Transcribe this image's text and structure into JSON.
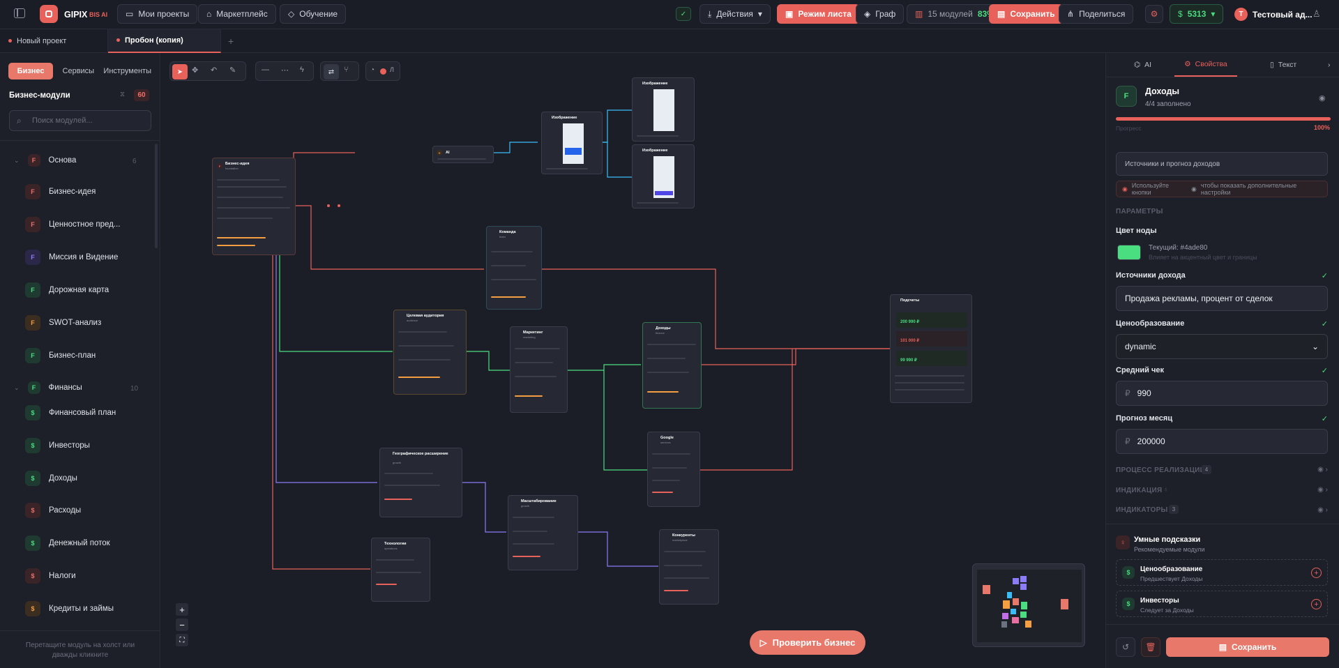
{
  "topbar": {
    "brand": "GIPIX",
    "brand_suffix": "BIS AI",
    "nav": [
      "Мои проекты",
      "Маркетплейс",
      "Обучение"
    ],
    "actions_label": "Действия",
    "sheet_mode_label": "Режим листа",
    "graph_label": "Граф",
    "modules_count": "15 модулей",
    "modules_percent": "83%",
    "save_label": "Сохранить",
    "share_label": "Поделиться",
    "credits": "5313",
    "user_initial": "Т",
    "user_name": "Тестовый ад..."
  },
  "tabs": [
    {
      "label": "Новый проект",
      "active": false
    },
    {
      "label": "Пробон (копия)",
      "active": true
    }
  ],
  "sidebar": {
    "segments": [
      "Бизнес",
      "Сервисы",
      "Инструменты"
    ],
    "title": "Бизнес-модули",
    "count": "60",
    "search_placeholder": "Поиск модулей...",
    "groups": [
      {
        "label": "Основа",
        "count": "6",
        "badge": "F"
      },
      {
        "label": "Финансы",
        "count": "10",
        "badge": "F"
      }
    ],
    "modules": [
      {
        "label": "Бизнес-идея",
        "badge": "F",
        "color": "red"
      },
      {
        "label": "Ценностное пред...",
        "badge": "F",
        "color": "red"
      },
      {
        "label": "Миссия и Видение",
        "badge": "F",
        "color": "blue"
      },
      {
        "label": "Дорожная карта",
        "badge": "F",
        "color": "green"
      },
      {
        "label": "SWOT-анализ",
        "badge": "F",
        "color": "orange"
      },
      {
        "label": "Бизнес-план",
        "badge": "F",
        "color": "green"
      },
      {
        "label": "Финансовый план",
        "badge": "$",
        "color": "green"
      },
      {
        "label": "Инвесторы",
        "badge": "$",
        "color": "green"
      },
      {
        "label": "Доходы",
        "badge": "$",
        "color": "green"
      },
      {
        "label": "Расходы",
        "badge": "$",
        "color": "red"
      },
      {
        "label": "Денежный поток",
        "badge": "$",
        "color": "green"
      },
      {
        "label": "Налоги",
        "badge": "$",
        "color": "red"
      },
      {
        "label": "Кредиты и займы",
        "badge": "$",
        "color": "orange"
      }
    ],
    "footer_hint": "Перетащите модуль на холст или дважды кликните"
  },
  "canvas": {
    "toolbar_slash": "Л",
    "nodes": [
      {
        "title": "Бизнес-идея",
        "sub": "foundation",
        "color": "#e8615a"
      },
      {
        "title": "AI",
        "sub": "",
        "color": "#f59e42"
      },
      {
        "title": "Изображение",
        "sub": "",
        "color": "#38bdf8"
      },
      {
        "title": "Изображение",
        "sub": "",
        "color": "#38bdf8"
      },
      {
        "title": "Изображение",
        "sub": "",
        "color": "#38bdf8"
      },
      {
        "title": "Команда",
        "sub": "team",
        "color": "#38bdf8"
      },
      {
        "title": "Целевая аудитория",
        "sub": "audience",
        "color": "#f59e42"
      },
      {
        "title": "Маркетинг",
        "sub": "marketing",
        "color": "#e8615a"
      },
      {
        "title": "Доходы",
        "sub": "finance",
        "color": "#4ade80"
      },
      {
        "title": "Подсчеты",
        "sub": "",
        "color": "#e8615a"
      },
      {
        "title": "Google",
        "sub": "services",
        "color": "#38bdf8"
      },
      {
        "title": "Географическое расширение",
        "sub": "growth",
        "color": "#8b7cf8"
      },
      {
        "title": "Масштабирование",
        "sub": "growth",
        "color": "#e8615a"
      },
      {
        "title": "Технологии",
        "sub": "operations",
        "color": "#e8615a"
      },
      {
        "title": "Конкуренты",
        "sub": "marketplace",
        "color": "#f59e42"
      }
    ],
    "totals": {
      "income": "200 990 ₽",
      "expense": "101 000 ₽",
      "profit": "99 990 ₽"
    },
    "check_button": "Проверить бизнес"
  },
  "panel": {
    "tabs": [
      "AI",
      "Свойства",
      "Текст"
    ],
    "node_badge": "F",
    "node_title": "Доходы",
    "node_filled": "4/4 заполнено",
    "progress_label": "Прогресс",
    "progress_value": "100%",
    "progress": 1.0,
    "description": "Источники и прогноз доходов",
    "hint_prefix": "Используйте кнопки",
    "hint_suffix": "чтобы показать дополнительные настройки",
    "params_title": "ПАРАМЕТРЫ",
    "color_label": "Цвет ноды",
    "color_current": "Текущий: #4ade80",
    "color_hint": "Влияет на акцентный цвет и границы",
    "node_color": "#4ade80",
    "income_sources_label": "Источники дохода",
    "income_sources_value": "Продажа рекламы, процент от сделок",
    "pricing_label": "Ценообразование",
    "pricing_value": "dynamic",
    "avg_check_label": "Средний чек",
    "avg_check_value": "990",
    "forecast_label": "Прогноз месяц",
    "forecast_value": "200000",
    "currency": "₽",
    "section_process": "ПРОЦЕСС РЕАЛИЗАЦИИ",
    "section_process_count": "4",
    "section_indication": "ИНДИКАЦИЯ",
    "section_indicators": "ИНДИКАТОРЫ",
    "section_indicators_count": "3",
    "tips_title": "Умные подсказки",
    "tips_sub": "Рекомендуемые модули",
    "tips": [
      {
        "title": "Ценообразование",
        "sub": "Предшествует Доходы"
      },
      {
        "title": "Инвесторы",
        "sub": "Следует за Доходы"
      }
    ],
    "save_label": "Сохранить"
  }
}
